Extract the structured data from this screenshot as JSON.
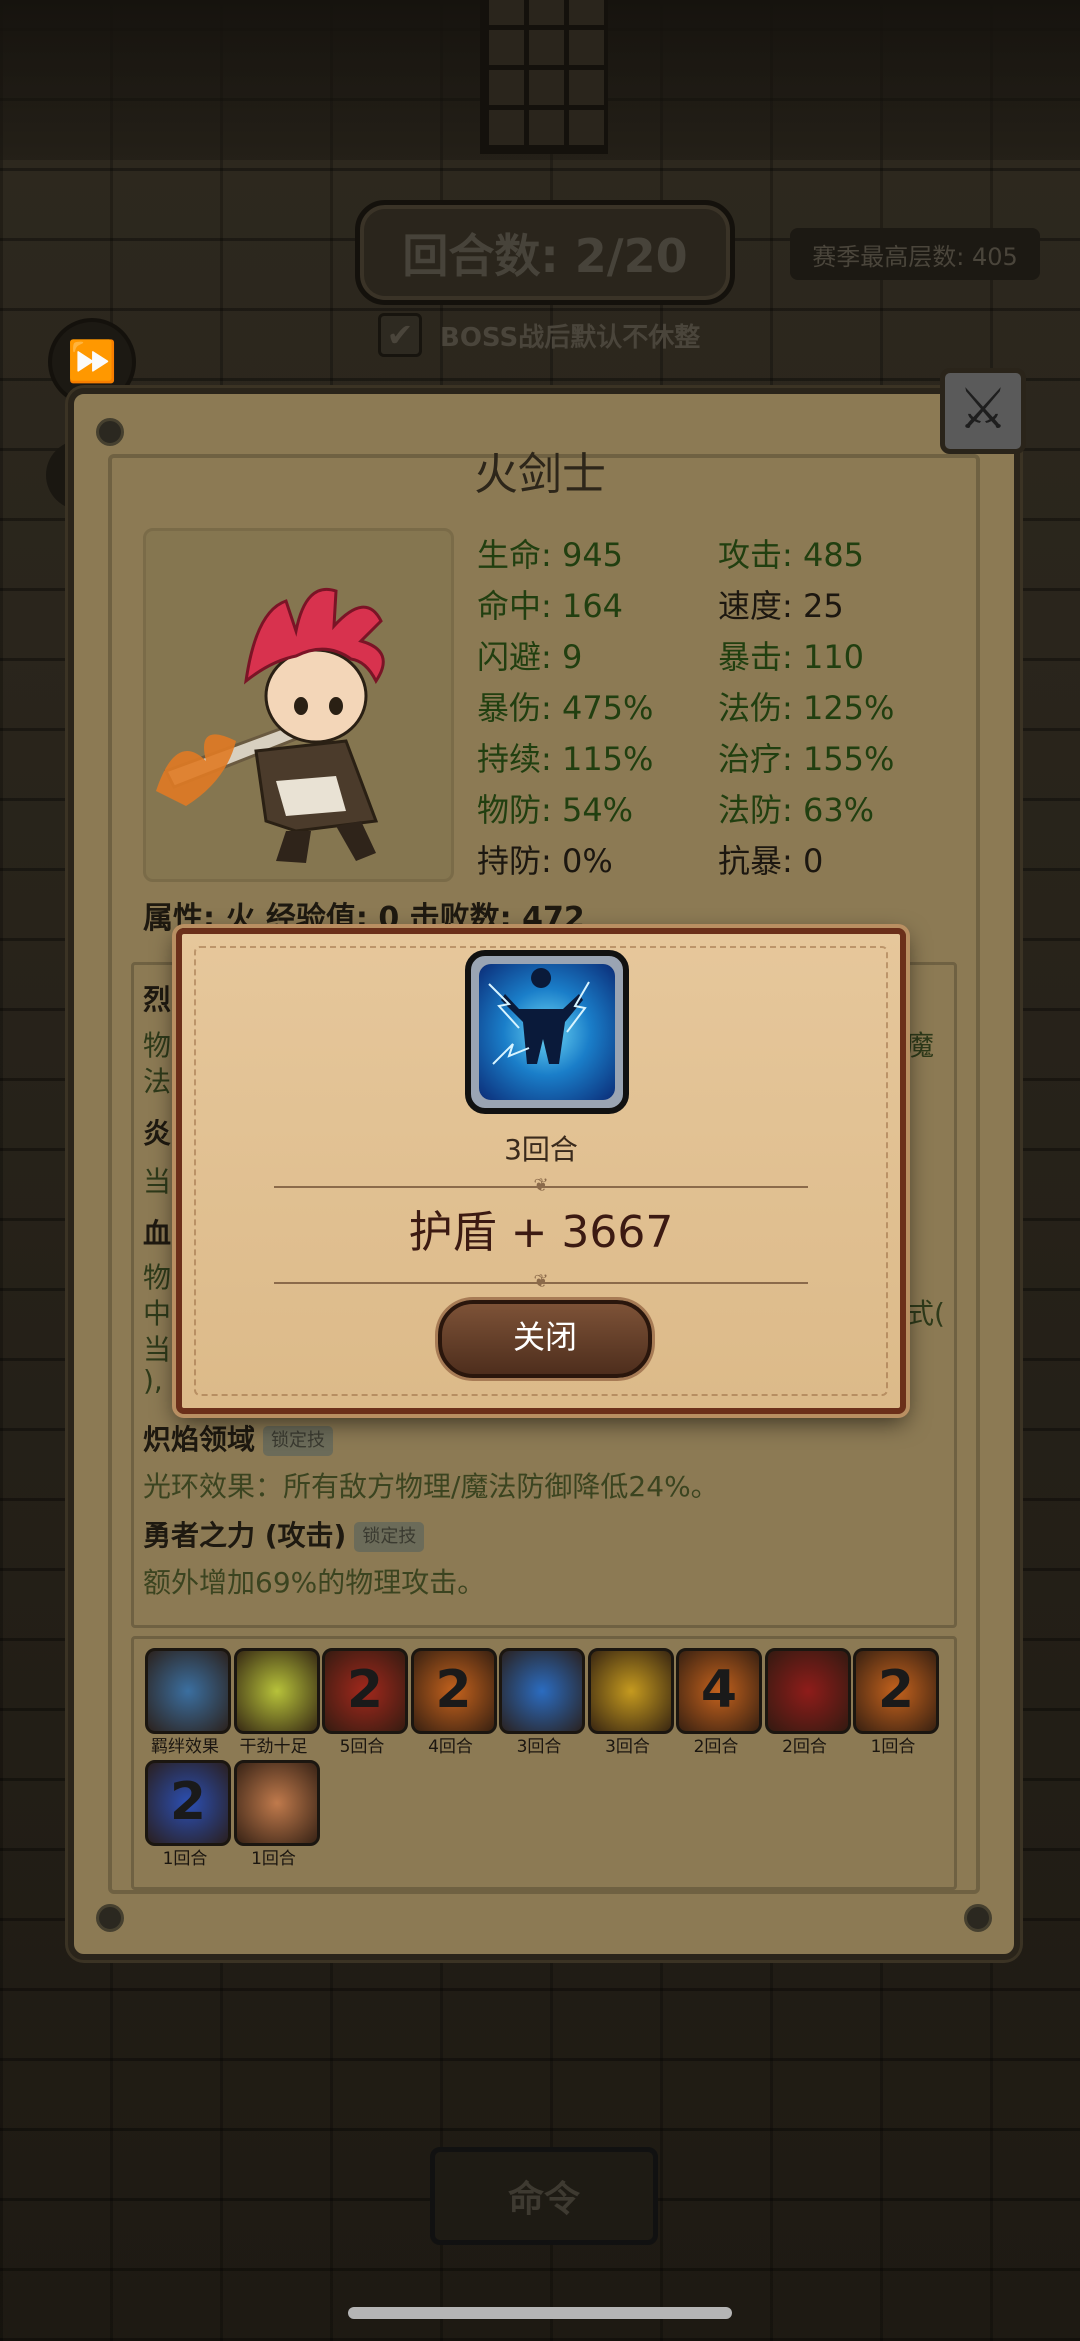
{
  "top": {
    "round_counter": "回合数: 2/20",
    "season_best": "赛季最高层数: 405",
    "boss_checkbox_label": "BOSS战后默认不休整",
    "boss_checkbox_checked": true
  },
  "hero": {
    "name": "火剑士",
    "stats": [
      {
        "label": "生命: 945",
        "color": "green"
      },
      {
        "label": "攻击: 485",
        "color": "green"
      },
      {
        "label": "命中: 164",
        "color": "green"
      },
      {
        "label": "速度: 25",
        "color": "dark"
      },
      {
        "label": "闪避: 9",
        "color": "green"
      },
      {
        "label": "暴击: 110",
        "color": "green"
      },
      {
        "label": "暴伤: 475%",
        "color": "green"
      },
      {
        "label": "法伤: 125%",
        "color": "green"
      },
      {
        "label": "持续: 115%",
        "color": "green"
      },
      {
        "label": "治疗: 155%",
        "color": "green"
      },
      {
        "label": "物防: 54%",
        "color": "green"
      },
      {
        "label": "法防: 63%",
        "color": "green"
      },
      {
        "label": "持防: 0%",
        "color": "dark"
      },
      {
        "label": "抗暴: 0",
        "color": "dark"
      }
    ],
    "attribute_line": "属性: 火  经验值: 0  击败数: 472"
  },
  "skills": {
    "partial_left": [
      "烈",
      "物",
      "法",
      "炎",
      "当",
      "血",
      "物",
      "中",
      "当",
      "),"
    ],
    "partial_right": [
      "魔",
      "式("
    ],
    "items": [
      {
        "name": "炽焰领域",
        "tag": "锁定技",
        "desc": "光环效果：所有敌方物理/魔法防御降低24%。"
      },
      {
        "name": "勇者之力 (攻击)",
        "tag": "锁定技",
        "desc": "额外增加69%的物理攻击。"
      }
    ]
  },
  "buffs": [
    {
      "symbol": "",
      "label": "羁绊效果",
      "icon": "bond-icon",
      "color": "#3b6fa0"
    },
    {
      "symbol": "",
      "label": "干劲十足",
      "icon": "energy-face-icon",
      "color": "#b7c23a"
    },
    {
      "symbol": "2",
      "label": "5回合",
      "icon": "fire-2-icon",
      "color": "#a2281c"
    },
    {
      "symbol": "2",
      "label": "4回合",
      "icon": "flame-2-icon",
      "color": "#c4621d"
    },
    {
      "symbol": "",
      "label": "3回合",
      "icon": "lightning-shield-icon",
      "color": "#2b6cc0"
    },
    {
      "symbol": "",
      "label": "3回合",
      "icon": "golden-shield-icon",
      "color": "#c59a1f"
    },
    {
      "symbol": "4",
      "label": "2回合",
      "icon": "flame-4-icon",
      "color": "#c4621d"
    },
    {
      "symbol": "",
      "label": "2回合",
      "icon": "red-sigil-icon",
      "color": "#8f1c1a"
    },
    {
      "symbol": "2",
      "label": "1回合",
      "icon": "flame-2-icon",
      "color": "#c4621d"
    },
    {
      "symbol": "2",
      "label": "1回合",
      "icon": "blue-2-icon",
      "color": "#2b4fb3"
    },
    {
      "symbol": "",
      "label": "1回合",
      "icon": "armor-shield-icon",
      "color": "#c07a4c"
    }
  ],
  "command_button": "命令",
  "popup": {
    "icon": "lightning-shield-icon",
    "rounds": "3回合",
    "effect": "护盾 + 3667",
    "close_label": "关闭"
  }
}
